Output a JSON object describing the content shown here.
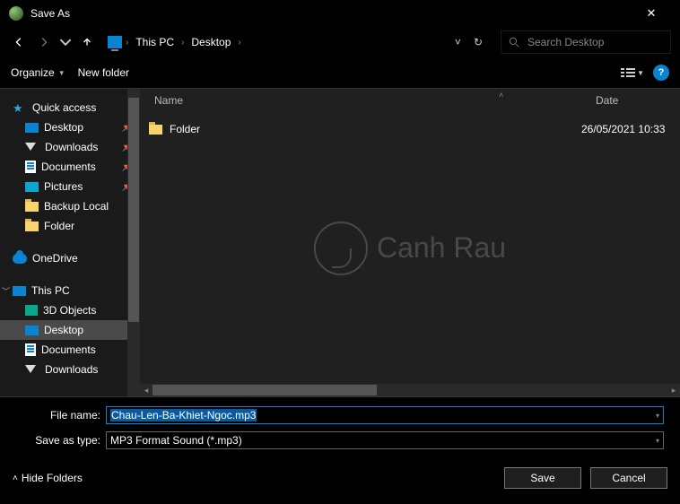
{
  "title": "Save As",
  "breadcrumb": {
    "pc": "This PC",
    "loc": "Desktop"
  },
  "search": {
    "placeholder": "Search Desktop"
  },
  "toolbar": {
    "organize": "Organize",
    "newfolder": "New folder"
  },
  "columns": {
    "name": "Name",
    "date": "Date"
  },
  "tree": {
    "quick": "Quick access",
    "desktop": "Desktop",
    "downloads": "Downloads",
    "documents": "Documents",
    "pictures": "Pictures",
    "backup": "Backup Local",
    "folder": "Folder",
    "onedrive": "OneDrive",
    "thispc": "This PC",
    "objects3d": "3D Objects",
    "desktop2": "Desktop",
    "documents2": "Documents",
    "downloads2": "Downloads"
  },
  "list": {
    "item0": {
      "name": "Folder",
      "date": "26/05/2021 10:33"
    }
  },
  "form": {
    "filename_label": "File name:",
    "filename_value": "Chau-Len-Ba-Khiet-Ngoc.mp3",
    "type_label": "Save as type:",
    "type_value": "MP3 Format Sound (*.mp3)"
  },
  "footer": {
    "hide": "Hide Folders",
    "save": "Save",
    "cancel": "Cancel"
  },
  "watermark": "Canh Rau"
}
